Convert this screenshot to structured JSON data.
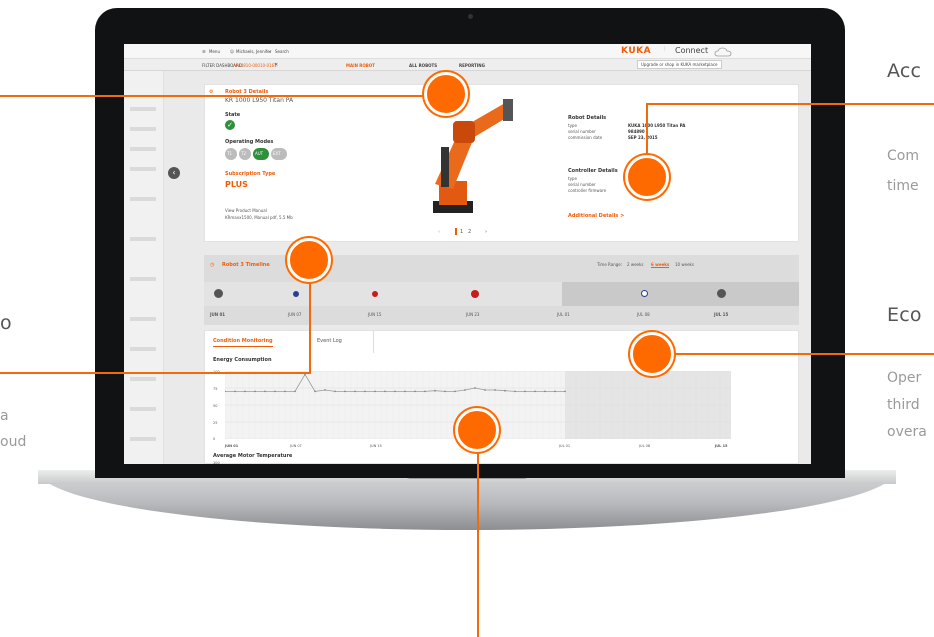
{
  "side": {
    "left_heading_partial": "o",
    "left_text_line1": "a",
    "left_text_line2": "oud",
    "right_heading1": "Acc",
    "right_text1_line1": "Com",
    "right_text1_line2": "time",
    "right_heading2": "Eco",
    "right_text2_line1": "Oper",
    "right_text2_line2": "third",
    "right_text2_line3": "overa"
  },
  "topbar": {
    "menu": "Menu",
    "user": "Michaels, Jennifer",
    "search": "Search",
    "brand": "KUKA",
    "connect": "Connect"
  },
  "filterbar": {
    "filter_label": "FILTER DASHBOARD:",
    "filter_value": "AP40810-00010-0161",
    "tab_main": "MAIN ROBOT",
    "tab_all": "ALL ROBOTS",
    "tab_reporting": "REPORTING",
    "upgrade": "Upgrade or shop in KUKA marketplace"
  },
  "robot": {
    "title": "Robot 3 Details",
    "model": "KR 1000 L950 Titan PA",
    "state_label": "State",
    "modes_label": "Operating Modes",
    "modes": [
      "T1",
      "T2",
      "AUT",
      "EXT"
    ],
    "sub_label": "Subscription Type",
    "sub_value": "PLUS",
    "manual_label": "View Product Manual",
    "manual_value": "KRmaxx1500, Manual pdf, 5.5 Mb",
    "pager_page": "1",
    "pager_next": "2"
  },
  "details": {
    "robot_heading": "Robot Details",
    "type_label": "type",
    "type_value": "KUKA 1000 L950 Titan PA",
    "serial_label": "serial number",
    "serial_value": "984890",
    "commission_label": "commission date",
    "commission_value": "SEP 23, 2015",
    "ctrl_heading": "Controller Details",
    "ctrl_type_label": "type",
    "ctrl_serial_label": "serial number",
    "ctrl_fw_label": "controller firmware",
    "ctrl_fw_value": "KSS 8.3.20",
    "additional": "Additional Details >"
  },
  "timeline": {
    "title": "Robot 3 Timeline",
    "range_label": "Time Range:",
    "range_options": [
      "2 weeks",
      "6 weeks",
      "10 weeks"
    ],
    "range_selected": "6 weeks",
    "dates": [
      "JUN 01",
      "JUN 07",
      "JUN 15",
      "JUN 23",
      "JUL 01",
      "JUL 08",
      "JUL 15"
    ]
  },
  "tabs": {
    "condition": "Condition Monitoring",
    "events": "Event Log"
  },
  "chart": {
    "title": "Energy Consumption",
    "y_ticks": [
      "100",
      "75",
      "50",
      "25",
      "0"
    ],
    "x_ticks": [
      "JUN 01",
      "JUN 07",
      "JUN 15",
      "JUL 01",
      "JUL 08",
      "JUL 15"
    ],
    "second_title": "Average Motor Temperature",
    "second_tick": "100"
  },
  "chart_data": {
    "type": "line",
    "title": "Energy Consumption",
    "x_range_labels": [
      "JUN 01",
      "JUL 15"
    ],
    "ylim": [
      0,
      100
    ],
    "series": [
      {
        "values": [
          70,
          70,
          70,
          70,
          70,
          70,
          70,
          70,
          95,
          70,
          72,
          70,
          70,
          70,
          70,
          70,
          70,
          70,
          70,
          70,
          70,
          71,
          70,
          70,
          72,
          75,
          72,
          72,
          71,
          70,
          70,
          70,
          70,
          70,
          70
        ]
      }
    ]
  }
}
